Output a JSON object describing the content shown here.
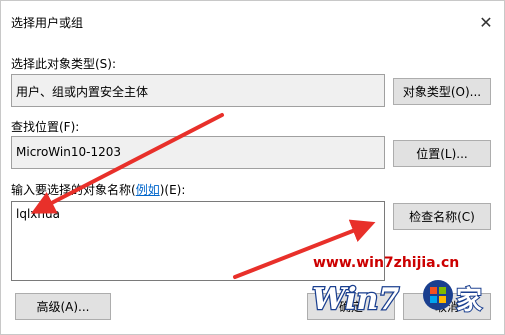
{
  "window": {
    "title": "选择用户或组",
    "close_glyph": "✕"
  },
  "object_type": {
    "label": "选择此对象类型(S):",
    "value": "用户、组或内置安全主体",
    "button_label": "对象类型(O)..."
  },
  "location": {
    "label": "查找位置(F):",
    "value": "MicroWin10-1203",
    "button_label": "位置(L)..."
  },
  "names": {
    "label_prefix": "输入要选择的对象名称(",
    "example_link": "例如",
    "label_suffix": ")(E):",
    "value": "lqlxhua",
    "check_button_label": "检查名称(C)"
  },
  "footer": {
    "advanced_button_label": "高级(A)...",
    "ok_button_label": "确定",
    "cancel_button_label": "取消"
  },
  "watermark": {
    "url": "www.win7zhijia.cn",
    "logo_text": "Win7",
    "logo_suffix": "家"
  },
  "colors": {
    "annotation_arrow": "#e8302a",
    "watermark_red": "#cc0000",
    "watermark_blue": "#1a3f8f",
    "link": "#0066cc"
  }
}
